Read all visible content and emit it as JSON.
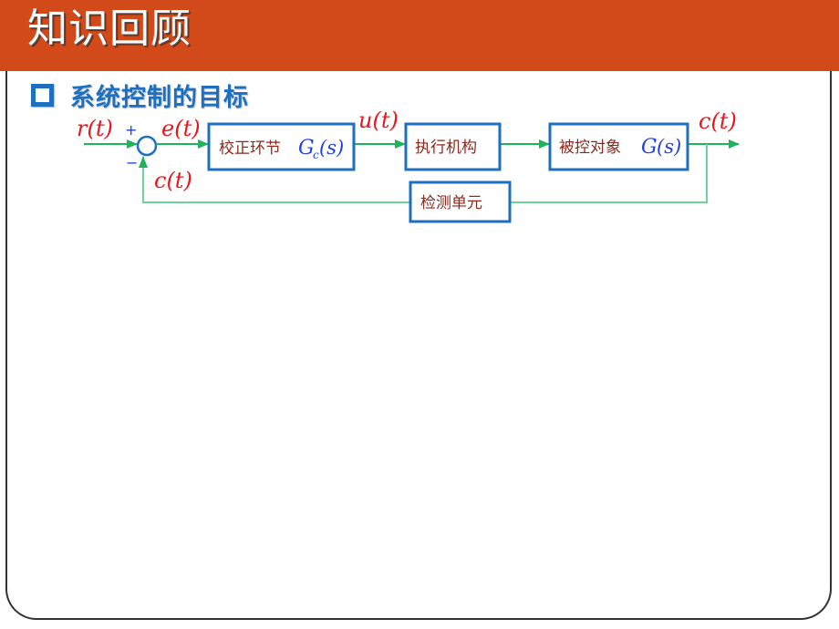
{
  "header": {
    "title": "知识回顾"
  },
  "section": {
    "bullet_icon": "hollow-square-icon",
    "title": "系统控制的目标"
  },
  "diagram": {
    "colors": {
      "line": "#1fb35a",
      "feedback_line": "#6dd39a",
      "box_border": "#1d6fc0",
      "block_text": "#8b2a1c",
      "transfer_fn": "#1f3fe0",
      "signal": "#e8141e",
      "sign": "#1f3fe0"
    },
    "signals": {
      "input": "r(t)",
      "error": "e(t)",
      "control": "u(t)",
      "output": "c(t)",
      "feedback": "c(t)"
    },
    "signs": {
      "plus": "+",
      "minus": "−"
    },
    "blocks": [
      {
        "label": "校正环节",
        "tf_main": "G",
        "tf_sub": "c",
        "tf_arg": "(s)"
      },
      {
        "label": "执行机构"
      },
      {
        "label": "被控对象",
        "tf_main": "G",
        "tf_arg": "(s)"
      },
      {
        "label": "检测单元"
      }
    ]
  }
}
